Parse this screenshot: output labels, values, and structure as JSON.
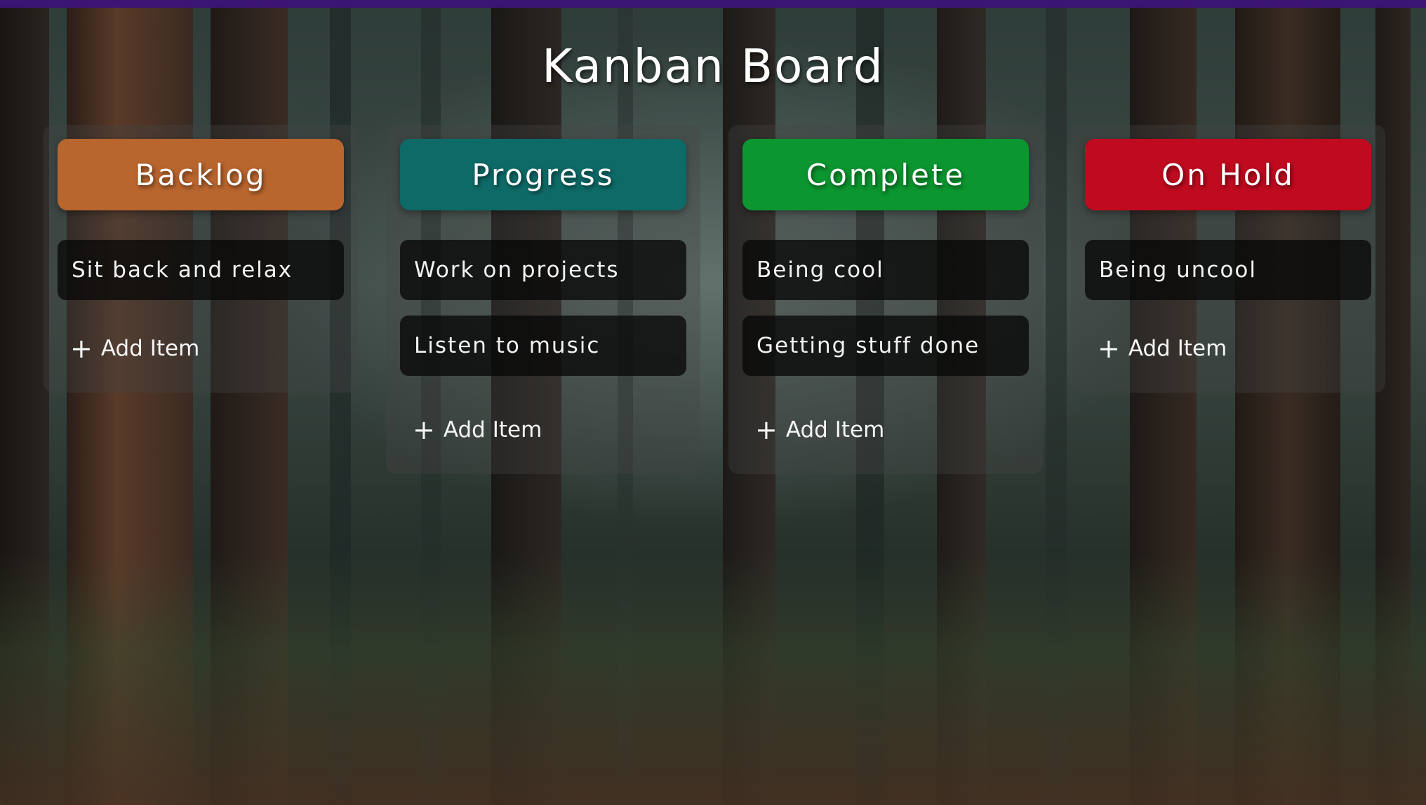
{
  "board": {
    "title": "Kanban Board"
  },
  "columns": [
    {
      "name": "Backlog",
      "color": "#b9652e",
      "items": [
        "Sit back and relax"
      ],
      "add_label": "Add Item"
    },
    {
      "name": "Progress",
      "color": "#0e6a67",
      "items": [
        "Work on projects",
        "Listen to music"
      ],
      "add_label": "Add Item"
    },
    {
      "name": "Complete",
      "color": "#0b962f",
      "items": [
        "Being cool",
        "Getting stuff done"
      ],
      "add_label": "Add Item"
    },
    {
      "name": "On Hold",
      "color": "#c00a1f",
      "items": [
        "Being uncool"
      ],
      "add_label": "Add Item"
    }
  ],
  "icons": {
    "add": "plus-icon"
  },
  "colors": {
    "top_bar": "#3b1474"
  }
}
